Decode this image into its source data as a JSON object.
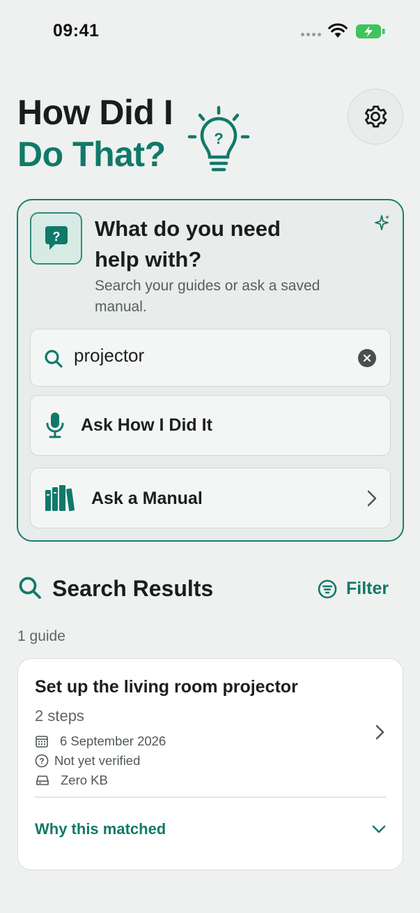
{
  "status_bar": {
    "time": "09:41"
  },
  "header": {
    "title_line1": "How Did I",
    "title_line2": "Do That?",
    "icons": {
      "bulb": "lightbulb-question-icon",
      "settings": "gear-icon"
    }
  },
  "help_card": {
    "title": "What do you need help with?",
    "subtitle": "Search your guides or ask a saved manual.",
    "search": {
      "value": "projector",
      "icon": "search-icon",
      "clear_icon": "clear-icon"
    },
    "ask_button": {
      "label": "Ask How I Did It",
      "icon": "microphone-icon"
    },
    "manual_button": {
      "label": "Ask a Manual",
      "icon": "books-icon"
    }
  },
  "results": {
    "title": "Search Results",
    "filter_label": "Filter",
    "count_text": "1 guide",
    "items": [
      {
        "title": "Set up the living room projector",
        "steps": "2 steps",
        "date": "6 September 2026",
        "verified": "Not yet verified",
        "size": "Zero KB",
        "why_label": "Why this matched"
      }
    ]
  },
  "colors": {
    "accent": "#10796a",
    "background": "#eef1ef",
    "card": "#ffffff",
    "text": "#1c1f1e",
    "muted": "#5d6662",
    "battery": "#3dc45a"
  }
}
